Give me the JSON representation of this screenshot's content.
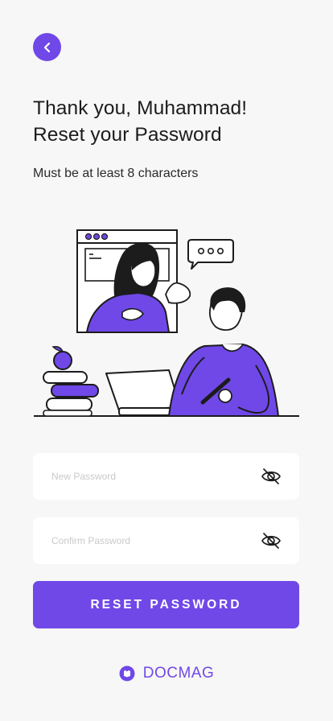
{
  "header": {
    "title_line1": "Thank you, Muhammad!",
    "title_line2": "Reset your Password",
    "subtitle": "Must be at least 8 characters"
  },
  "form": {
    "new_password_placeholder": "New Password",
    "confirm_password_placeholder": "Confirm Password",
    "new_password_icon": "eye-off-icon",
    "confirm_password_icon": "eye-off-icon",
    "submit_label": "RESET PASSWORD"
  },
  "footer": {
    "brand_name": "DOCMAG",
    "brand_icon": "docmag-logo-icon"
  },
  "colors": {
    "accent": "#7048e8",
    "background": "#f7f7f7",
    "field_background": "#ffffff"
  }
}
